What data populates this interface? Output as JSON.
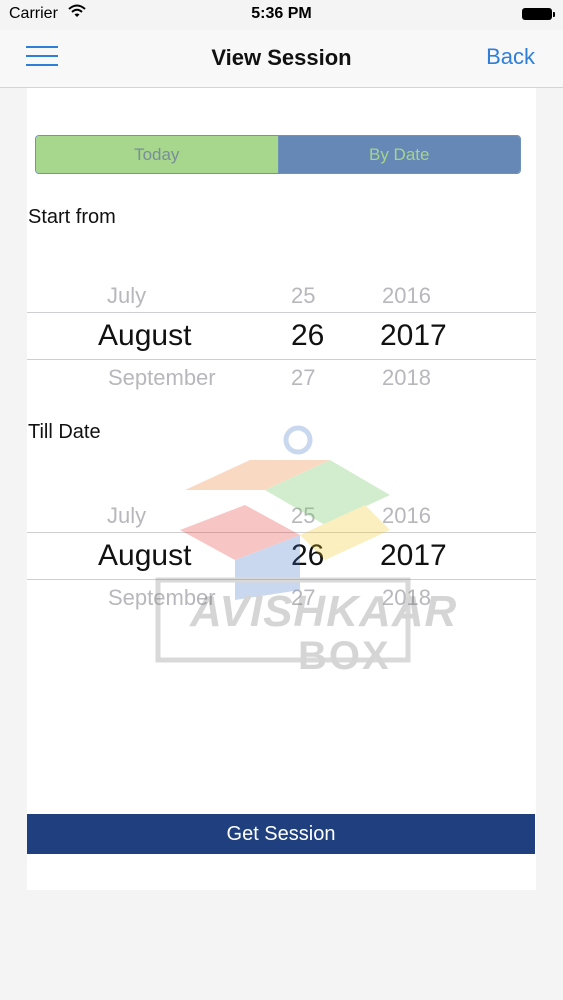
{
  "status_bar": {
    "carrier": "Carrier",
    "time": "5:36 PM"
  },
  "nav": {
    "title": "View Session",
    "back_label": "Back"
  },
  "segments": {
    "today": "Today",
    "by_date": "By Date"
  },
  "start": {
    "label": "Start from",
    "prev": {
      "month": "July",
      "day": "25",
      "year": "2016"
    },
    "selected": {
      "month": "August",
      "day": "26",
      "year": "2017"
    },
    "next": {
      "month": "September",
      "day": "27",
      "year": "2018"
    }
  },
  "till": {
    "label": "Till Date",
    "prev": {
      "month": "July",
      "day": "25",
      "year": "2016"
    },
    "selected": {
      "month": "August",
      "day": "26",
      "year": "2017"
    },
    "next": {
      "month": "September",
      "day": "27",
      "year": "2018"
    }
  },
  "watermark": {
    "line1": "AVISHKAAR",
    "line2": "BOX"
  },
  "action": {
    "get_session_label": "Get Session"
  },
  "colors": {
    "accent": "#2f7fd9",
    "segment_today": "#a6d78d",
    "segment_bydate": "#6588b7",
    "primary_button": "#1f3f7e"
  },
  "icons": {
    "menu": "hamburger-menu-icon",
    "wifi": "wifi-icon",
    "battery": "battery-icon"
  }
}
